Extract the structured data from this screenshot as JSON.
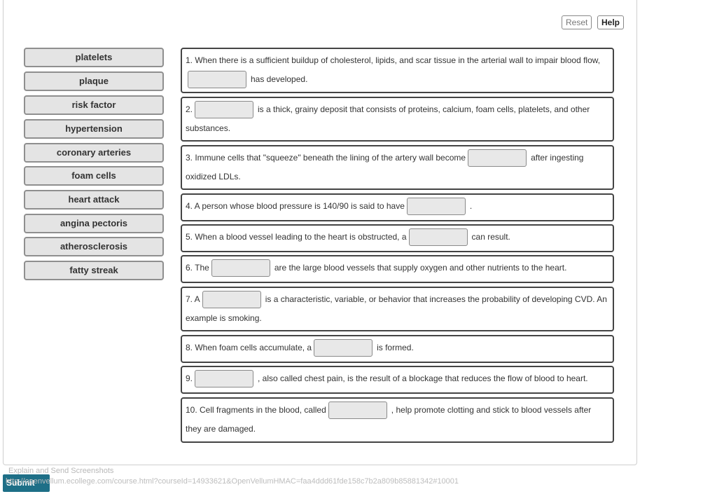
{
  "toolbar": {
    "reset_label": "Reset",
    "help_label": "Help"
  },
  "word_bank": [
    "platelets",
    "plaque",
    "risk factor",
    "hypertension",
    "coronary arteries",
    "foam cells",
    "heart attack",
    "angina pectoris",
    "atherosclerosis",
    "fatty streak"
  ],
  "questions": [
    {
      "before": "1. When there is a sufficient buildup of cholesterol, lipids, and scar tissue in the arterial wall to impair blood flow,",
      "after": "has developed."
    },
    {
      "before": "2.",
      "after": "is a thick, grainy deposit that consists of proteins, calcium, foam cells, platelets, and other substances."
    },
    {
      "before": "3. Immune cells that \"squeeze\" beneath the lining of the artery wall become",
      "after": "after ingesting oxidized LDLs."
    },
    {
      "before": "4. A person whose blood pressure is 140/90 is said to have",
      "after": "."
    },
    {
      "before": "5. When a blood vessel leading to the heart is obstructed, a",
      "after": "can result."
    },
    {
      "before": "6. The",
      "after": "are the large blood vessels that supply oxygen and other nutrients to the heart."
    },
    {
      "before": "7. A",
      "after": "is a characteristic, variable, or behavior that increases the probability of developing CVD. An example is smoking."
    },
    {
      "before": "8. When foam cells accumulate, a",
      "after": "is formed."
    },
    {
      "before": "9.",
      "after": ", also called chest pain, is the result of a blockage that reduces the flow of blood to heart."
    },
    {
      "before": "10. Cell fragments in the blood, called",
      "after": ", help promote clotting and stick to blood vessels after they are damaged."
    }
  ],
  "footer": {
    "explain_label": "Explain and Send Screenshots",
    "submit_label": "Submit",
    "url": "http://openvellum.ecollege.com/course.html?courseId=14933621&OpenVellumHMAC=faa4ddd61fde158c7b2a809b85881342#10001"
  }
}
